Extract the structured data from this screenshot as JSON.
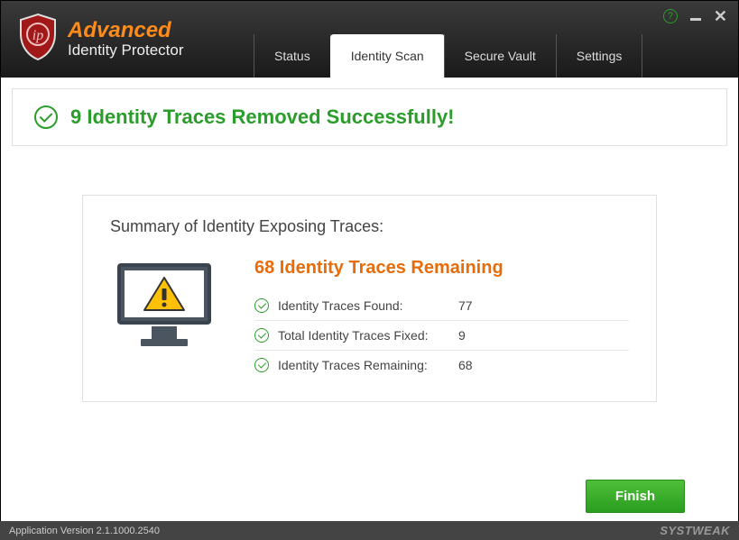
{
  "brand": {
    "main": "Advanced",
    "sub": "Identity Protector"
  },
  "tabs": {
    "status": "Status",
    "identity_scan": "Identity Scan",
    "secure_vault": "Secure Vault",
    "settings": "Settings"
  },
  "banner": {
    "message": "9 Identity Traces Removed Successfully!"
  },
  "summary": {
    "title": "Summary of Identity Exposing Traces:",
    "remaining_headline": "68 Identity Traces Remaining",
    "rows": {
      "found": {
        "label": "Identity Traces Found:",
        "value": "77"
      },
      "fixed": {
        "label": "Total Identity Traces Fixed:",
        "value": "9"
      },
      "remaining": {
        "label": "Identity Traces Remaining:",
        "value": "68"
      }
    }
  },
  "buttons": {
    "finish": "Finish"
  },
  "footer": {
    "version": "Application Version 2.1.1000.2540",
    "vendor": "SYSTWEAK"
  }
}
